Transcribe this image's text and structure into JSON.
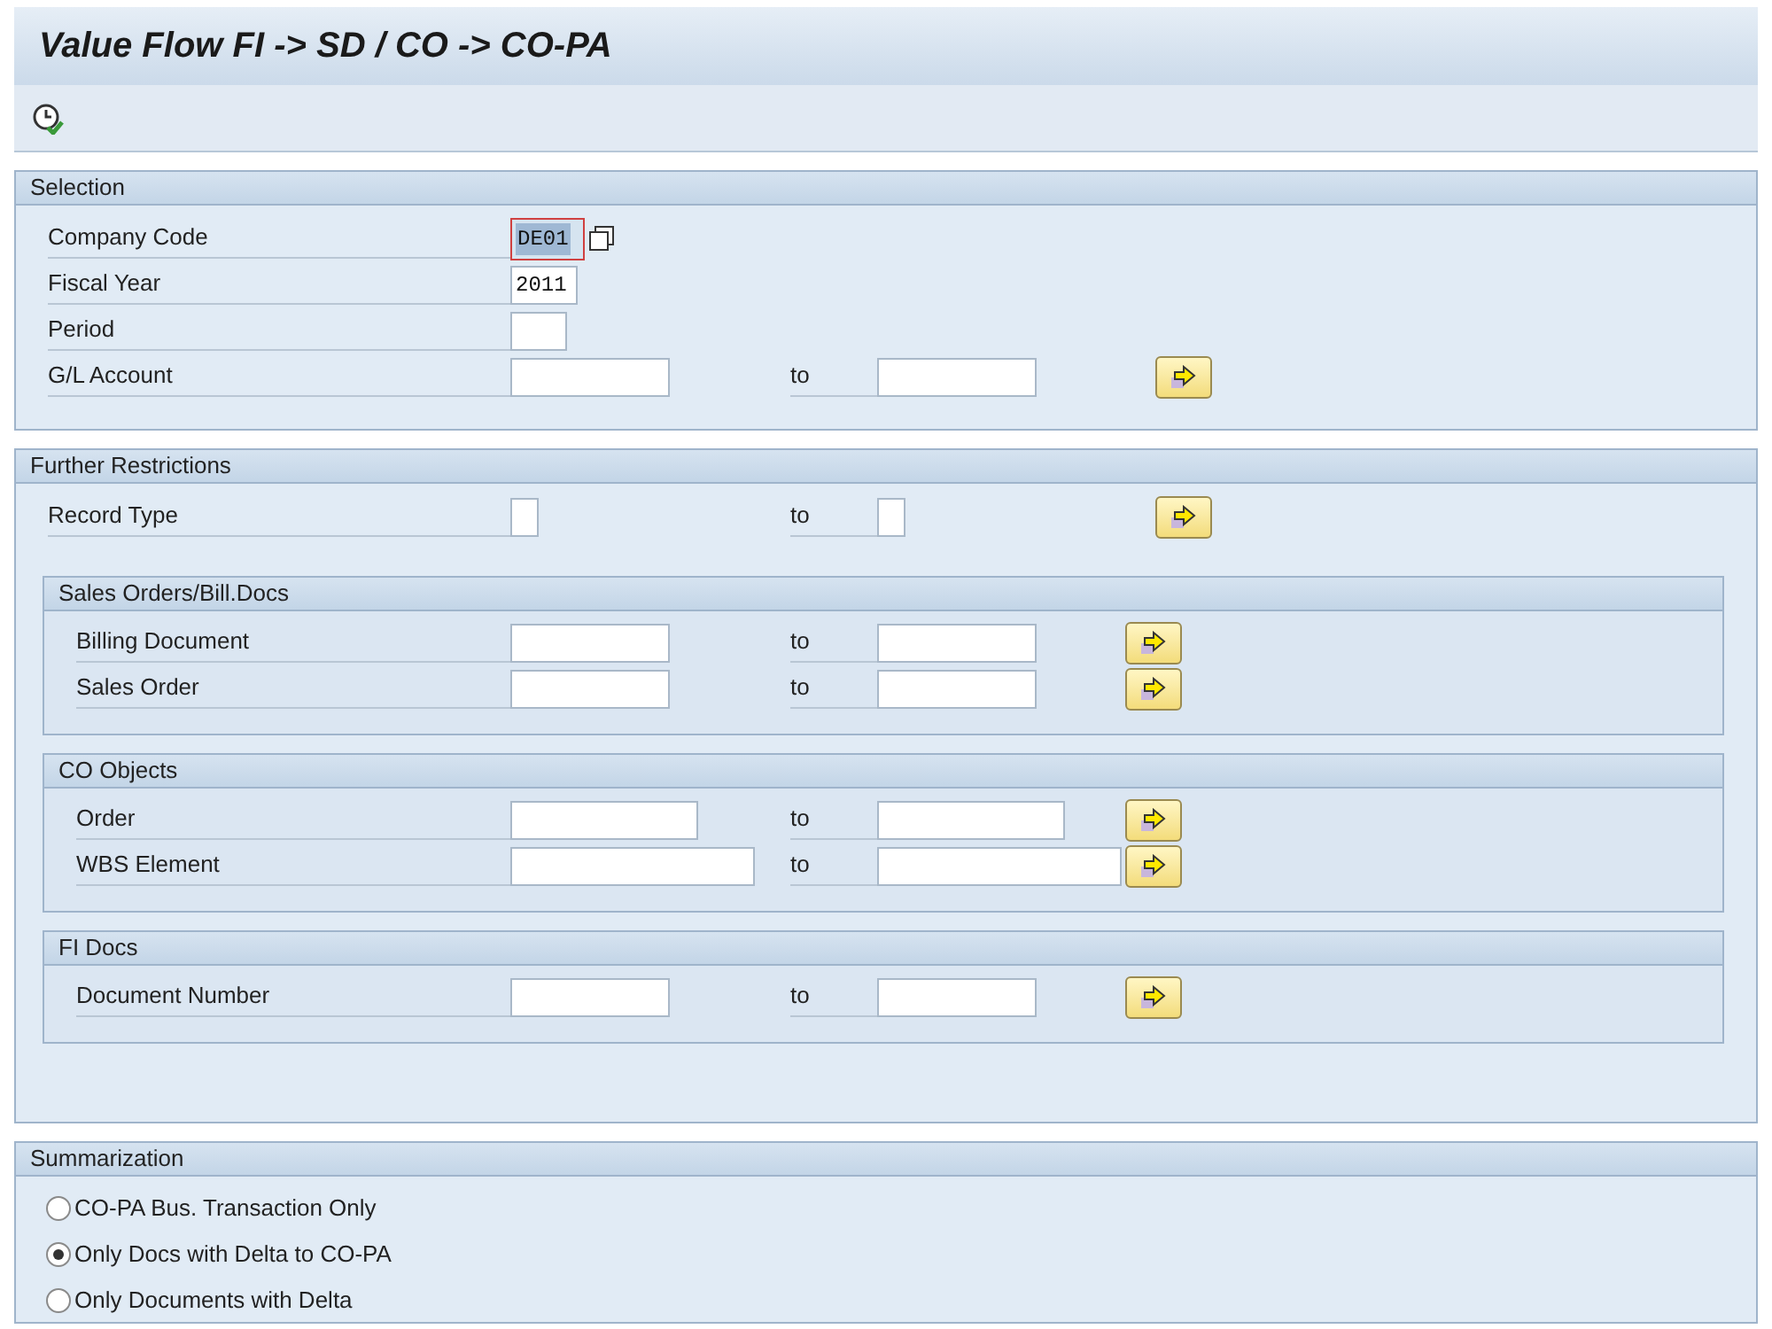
{
  "window": {
    "title": "Value Flow FI -> SD / CO -> CO-PA"
  },
  "selection": {
    "title": "Selection",
    "fields": [
      {
        "label": "Company Code",
        "value": "DE01",
        "focused": true
      },
      {
        "label": "Fiscal Year",
        "value": "2011",
        "focused": false
      },
      {
        "label": "Period",
        "focused": false
      },
      {
        "label": "G/L Account",
        "to": "to",
        "focused": false
      }
    ]
  },
  "further_restrictions": {
    "title": "Further Restrictions",
    "fields": [
      {
        "label": "Record Type",
        "to": "to"
      }
    ],
    "groups": [
      {
        "title": "Sales Orders/Bill.Docs",
        "fields": [
          {
            "label": "Billing Document",
            "to": "to"
          },
          {
            "label": "Sales Order",
            "to": "to"
          }
        ]
      },
      {
        "title": "CO Objects",
        "fields": [
          {
            "label": "Order",
            "to": "to"
          },
          {
            "label": "WBS Element",
            "to": "to"
          }
        ]
      },
      {
        "title": "FI Docs",
        "fields": [
          {
            "label": "Document Number",
            "to": "to"
          }
        ]
      }
    ]
  },
  "summarization": {
    "title": "Summarization",
    "options": [
      {
        "label": "CO-PA Bus. Transaction Only",
        "selected": false
      },
      {
        "label": "Only Docs with Delta to CO-PA",
        "selected": true
      },
      {
        "label": "Only Documents with Delta",
        "selected": false
      }
    ]
  }
}
